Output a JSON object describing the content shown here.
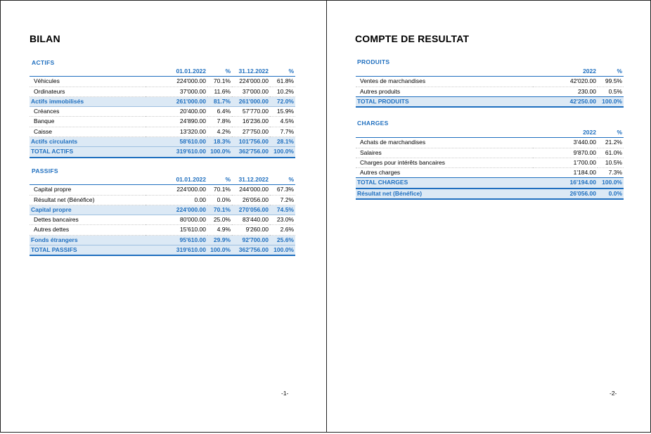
{
  "bilan": {
    "title": "BILAN",
    "actifs": {
      "section": "ACTIFS",
      "headers": [
        "",
        "01.01.2022",
        "%",
        "31.12.2022",
        "%"
      ],
      "rows": [
        {
          "label": "Véhicules",
          "v1": "224'000.00",
          "p1": "70.1%",
          "v2": "224'000.00",
          "p2": "61.8%"
        },
        {
          "label": "Ordinateurs",
          "v1": "37'000.00",
          "p1": "11.6%",
          "v2": "37'000.00",
          "p2": "10.2%"
        },
        {
          "label": "Actifs immobilisés",
          "v1": "261'000.00",
          "p1": "81.7%",
          "v2": "261'000.00",
          "p2": "72.0%"
        },
        {
          "label": "Créances",
          "v1": "20'400.00",
          "p1": "6.4%",
          "v2": "57'770.00",
          "p2": "15.9%"
        },
        {
          "label": "Banque",
          "v1": "24'890.00",
          "p1": "7.8%",
          "v2": "16'236.00",
          "p2": "4.5%"
        },
        {
          "label": "Caisse",
          "v1": "13'320.00",
          "p1": "4.2%",
          "v2": "27'750.00",
          "p2": "7.7%"
        },
        {
          "label": "Actifs circulants",
          "v1": "58'610.00",
          "p1": "18.3%",
          "v2": "101'756.00",
          "p2": "28.1%"
        },
        {
          "label": "TOTAL ACTIFS",
          "v1": "319'610.00",
          "p1": "100.0%",
          "v2": "362'756.00",
          "p2": "100.0%"
        }
      ]
    },
    "passifs": {
      "section": "PASSIFS",
      "headers": [
        "",
        "01.01.2022",
        "%",
        "31.12.2022",
        "%"
      ],
      "rows": [
        {
          "label": "Capital propre",
          "v1": "224'000.00",
          "p1": "70.1%",
          "v2": "244'000.00",
          "p2": "67.3%"
        },
        {
          "label": "Résultat net (Bénéfice)",
          "v1": "0.00",
          "p1": "0.0%",
          "v2": "26'056.00",
          "p2": "7.2%"
        },
        {
          "label": "Capital propre",
          "v1": "224'000.00",
          "p1": "70.1%",
          "v2": "270'056.00",
          "p2": "74.5%"
        },
        {
          "label": "Dettes bancaires",
          "v1": "80'000.00",
          "p1": "25.0%",
          "v2": "83'440.00",
          "p2": "23.0%"
        },
        {
          "label": "Autres dettes",
          "v1": "15'610.00",
          "p1": "4.9%",
          "v2": "9'260.00",
          "p2": "2.6%"
        },
        {
          "label": "Fonds étrangers",
          "v1": "95'610.00",
          "p1": "29.9%",
          "v2": "92'700.00",
          "p2": "25.6%"
        },
        {
          "label": "TOTAL PASSIFS",
          "v1": "319'610.00",
          "p1": "100.0%",
          "v2": "362'756.00",
          "p2": "100.0%"
        }
      ]
    },
    "page_number": "-1-"
  },
  "compte": {
    "title": "COMPTE DE RESULTAT",
    "produits": {
      "section": "PRODUITS",
      "headers": [
        "",
        "2022",
        "%"
      ],
      "rows": [
        {
          "label": "Ventes de marchandises",
          "v": "42'020.00",
          "p": "99.5%"
        },
        {
          "label": "Autres produits",
          "v": "230.00",
          "p": "0.5%"
        },
        {
          "label": "TOTAL PRODUITS",
          "v": "42'250.00",
          "p": "100.0%"
        }
      ]
    },
    "charges": {
      "section": "CHARGES",
      "headers": [
        "",
        "2022",
        "%"
      ],
      "rows": [
        {
          "label": "Achats de marchandises",
          "v": "3'440.00",
          "p": "21.2%"
        },
        {
          "label": "Salaires",
          "v": "9'870.00",
          "p": "61.0%"
        },
        {
          "label": "Charges pour intérêts bancaires",
          "v": "1'700.00",
          "p": "10.5%"
        },
        {
          "label": "Autres charges",
          "v": "1'184.00",
          "p": "7.3%"
        },
        {
          "label": "TOTAL CHARGES",
          "v": "16'194.00",
          "p": "100.0%"
        },
        {
          "label": "Résultat net (Bénéfice)",
          "v": "26'056.00",
          "p": "0.0%"
        }
      ]
    },
    "page_number": "-2-"
  }
}
